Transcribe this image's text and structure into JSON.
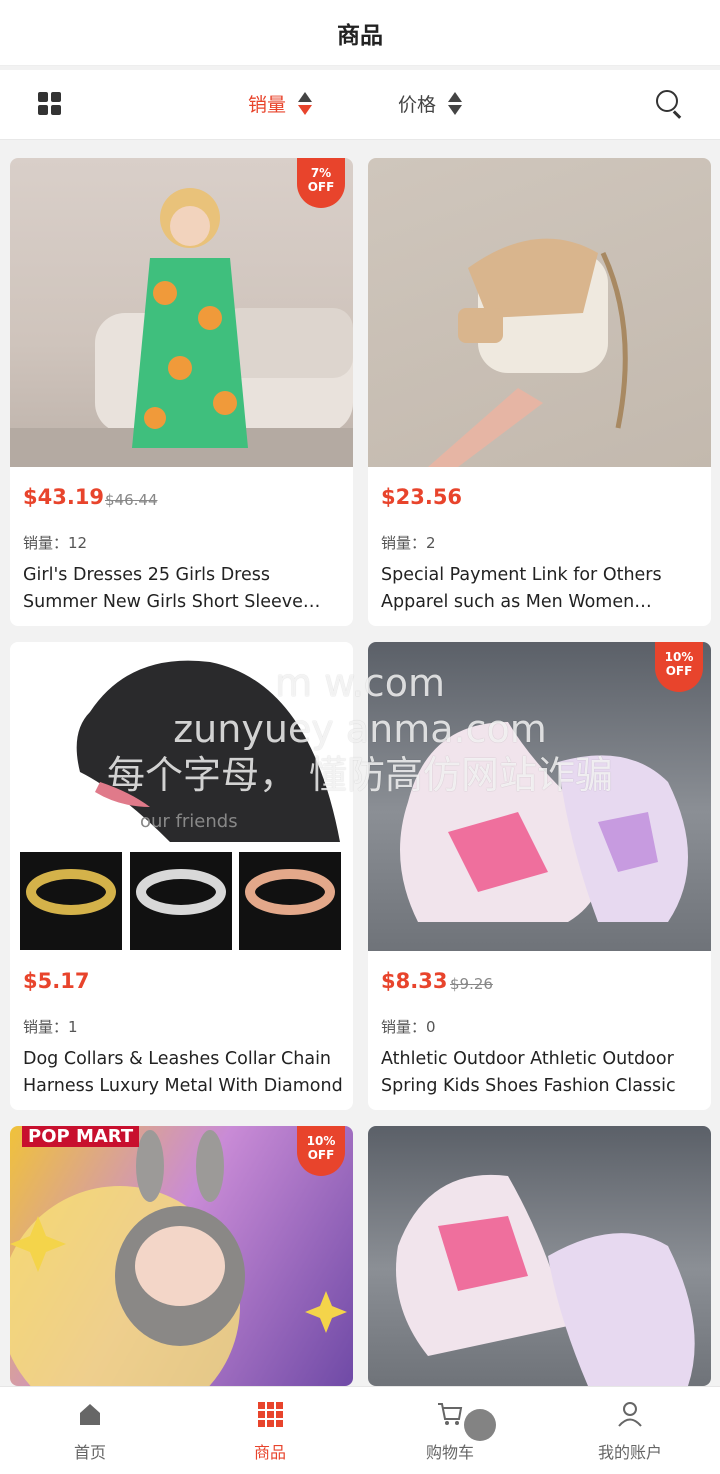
{
  "header": {
    "title": "商品"
  },
  "filter": {
    "sort_sales_label": "销量",
    "sort_price_label": "价格"
  },
  "products": [
    {
      "price": "$43.19",
      "old_price": "$46.44",
      "sales": "销量：12",
      "name": "Girl's Dresses 25 Girls Dress Summer New Girls Short Sleeve Dress Casual",
      "badge": "7%\nOFF"
    },
    {
      "price": "$23.56",
      "old_price": "",
      "sales": "销量：2",
      "name": "Special Payment Link for Others Apparel such as Men Women clothes",
      "badge": ""
    },
    {
      "price": "$5.17",
      "old_price": "",
      "sales": "销量：1",
      "name": "Dog Collars & Leashes Collar Chain Harness Luxury Metal With Diamond",
      "badge": ""
    },
    {
      "price": "$8.33",
      "old_price": "$9.26",
      "sales": "销量：0",
      "name": "Athletic Outdoor Athletic Outdoor Spring Kids Shoes Fashion Classic",
      "badge": "10%\nOFF"
    },
    {
      "price": "",
      "old_price": "",
      "sales": "",
      "name": "",
      "badge": "10%\nOFF",
      "brand": "POP MART"
    },
    {
      "price": "",
      "old_price": "",
      "sales": "",
      "name": "",
      "badge": ""
    }
  ],
  "images": {
    "dog_caption": "our friends"
  },
  "watermark": [
    "m      w.com",
    "zunyuey  anma.com",
    "每个字母，  懂防高仿网站诈骗"
  ],
  "tabbar": [
    {
      "label": "首页",
      "icon": "home-icon"
    },
    {
      "label": "商品",
      "icon": "grid-icon"
    },
    {
      "label": "购物车",
      "icon": "cart-icon"
    },
    {
      "label": "我的账户",
      "icon": "user-icon"
    }
  ],
  "colors": {
    "accent": "#e8442c"
  }
}
